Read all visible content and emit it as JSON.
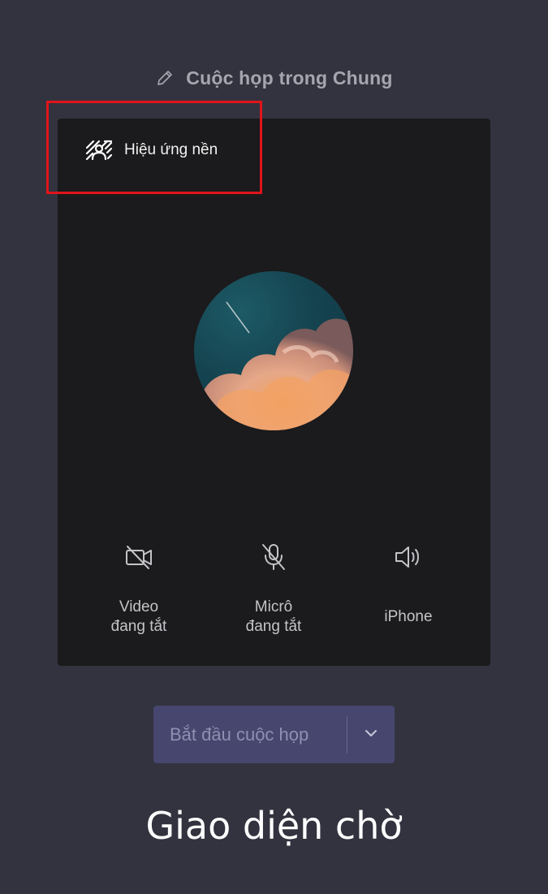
{
  "header": {
    "edit_icon": "pencil-icon",
    "meeting_title": "Cuộc họp trong Chung"
  },
  "preview": {
    "background_effects": {
      "icon": "background-effects-icon",
      "label": "Hiệu ứng nền"
    },
    "avatar_image": "cloud-sky-photo",
    "controls": [
      {
        "icon": "video-off-icon",
        "label": "Video\nđang tắt"
      },
      {
        "icon": "mic-off-icon",
        "label": "Micrô\nđang tắt"
      },
      {
        "icon": "speaker-icon",
        "label": "iPhone"
      }
    ]
  },
  "actions": {
    "start_label": "Bắt đầu cuộc họp",
    "dropdown_icon": "chevron-down-icon"
  },
  "caption": "Giao diện chờ",
  "colors": {
    "background": "#33333f",
    "preview_bg": "#1b1a1c",
    "highlight": "#e0141a",
    "button_bg": "#46466e"
  }
}
